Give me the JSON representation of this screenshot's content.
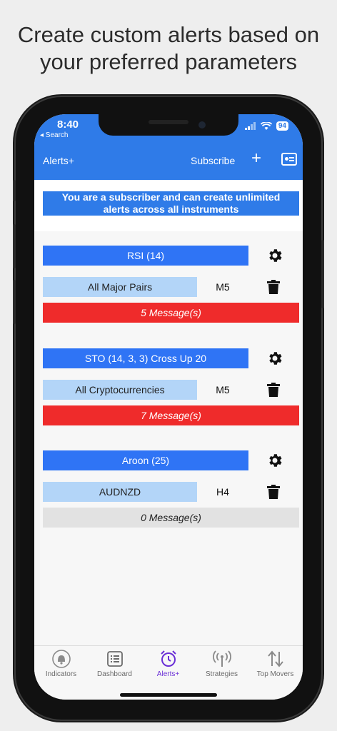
{
  "headline": {
    "line1": "Create custom alerts based on",
    "line2": "your preferred parameters"
  },
  "status_bar": {
    "time": "8:40",
    "back_label": "◂ Search",
    "battery": "94"
  },
  "nav": {
    "title": "Alerts+",
    "subscribe_label": "Subscribe",
    "add_icon": "plus-icon",
    "profile_icon": "profile-card-icon"
  },
  "banner": {
    "line1": "You are a subscriber and can create unlimited",
    "line2": "alerts across all instruments"
  },
  "alerts": [
    {
      "indicator": "RSI (14)",
      "instrument": "All Major Pairs",
      "timeframe": "M5",
      "messages": "5 Message(s)",
      "has_messages": true
    },
    {
      "indicator": "STO (14, 3, 3) Cross Up 20",
      "instrument": "All Cryptocurrencies",
      "timeframe": "M5",
      "messages": "7 Message(s)",
      "has_messages": true
    },
    {
      "indicator": "Aroon (25)",
      "instrument": "AUDNZD",
      "timeframe": "H4",
      "messages": "0 Message(s)",
      "has_messages": false
    }
  ],
  "tabs": [
    {
      "label": "Indicators",
      "icon": "bell-icon",
      "active": false
    },
    {
      "label": "Dashboard",
      "icon": "list-icon",
      "active": false
    },
    {
      "label": "Alerts+",
      "icon": "alarm-clock-icon",
      "active": true
    },
    {
      "label": "Strategies",
      "icon": "broadcast-icon",
      "active": false
    },
    {
      "label": "Top Movers",
      "icon": "up-down-arrows-icon",
      "active": false
    }
  ],
  "colors": {
    "primary": "#2f7be8",
    "indicator_bar": "#2f74f5",
    "instrument_bar": "#b3d5f8",
    "message_alert": "#ef2b2b",
    "message_empty": "#e2e2e2",
    "active_tab": "#6a2fd6"
  }
}
